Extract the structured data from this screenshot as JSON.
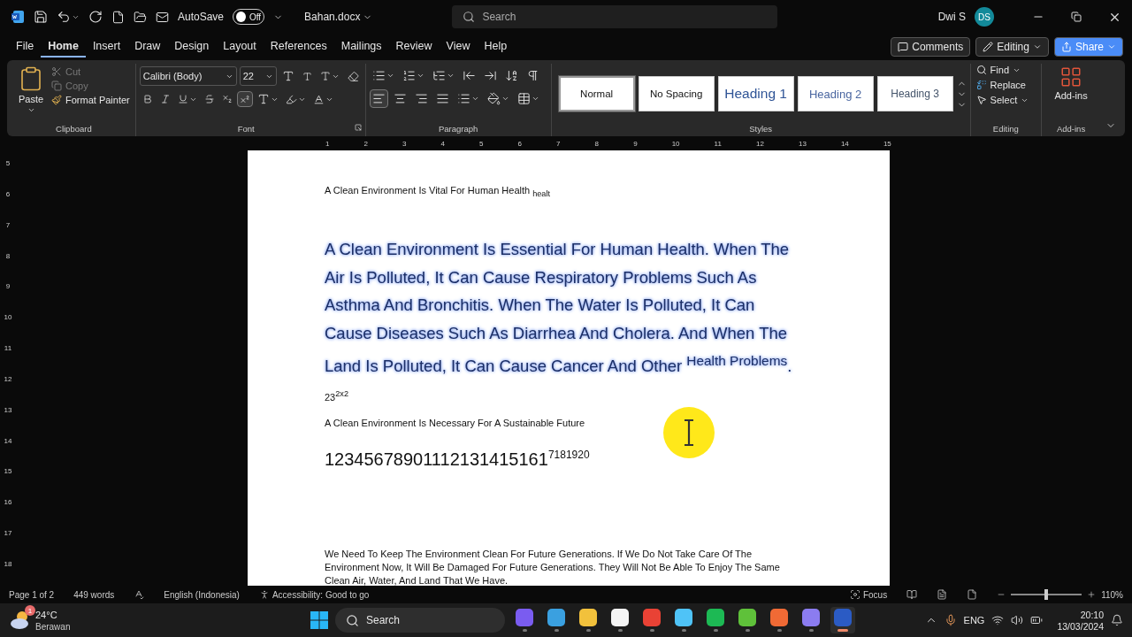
{
  "titlebar": {
    "autosave_label": "AutoSave",
    "autosave_on": false,
    "autosave_state": "Off",
    "filename": "Bahan.docx",
    "search_placeholder": "Search",
    "user_name": "Dwi S",
    "user_initials": "DS"
  },
  "menu_tabs": [
    {
      "label": "File",
      "selected": false
    },
    {
      "label": "Home",
      "selected": true
    },
    {
      "label": "Insert",
      "selected": false
    },
    {
      "label": "Draw",
      "selected": false
    },
    {
      "label": "Design",
      "selected": false
    },
    {
      "label": "Layout",
      "selected": false
    },
    {
      "label": "References",
      "selected": false
    },
    {
      "label": "Mailings",
      "selected": false
    },
    {
      "label": "Review",
      "selected": false
    },
    {
      "label": "View",
      "selected": false
    },
    {
      "label": "Help",
      "selected": false
    }
  ],
  "actions": {
    "comments": "Comments",
    "editing": "Editing",
    "share": "Share"
  },
  "ribbon": {
    "clipboard": {
      "paste": "Paste",
      "cut": "Cut",
      "copy": "Copy",
      "format_painter": "Format Painter",
      "label": "Clipboard"
    },
    "font": {
      "family": "Calibri (Body)",
      "size": "22",
      "label": "Font",
      "superscript_on": true
    },
    "paragraph": {
      "label": "Paragraph",
      "align_left_on": true
    },
    "styles": {
      "label": "Styles",
      "items": [
        {
          "label": "Normal",
          "kind": "normal",
          "selected": true
        },
        {
          "label": "No Spacing",
          "kind": "normal",
          "selected": false
        },
        {
          "label": "Heading 1",
          "kind": "heading1",
          "selected": false
        },
        {
          "label": "Heading 2",
          "kind": "heading2",
          "selected": false
        },
        {
          "label": "Heading 3",
          "kind": "heading3",
          "selected": false
        }
      ]
    },
    "editing": {
      "find": "Find",
      "replace": "Replace",
      "select": "Select",
      "label": "Editing"
    },
    "addins": {
      "button": "Add-ins",
      "label": "Add-ins"
    }
  },
  "ruler": {
    "numbers": [
      "1",
      "2",
      "3",
      "4",
      "5",
      "6",
      "7",
      "8",
      "9",
      "10",
      "11",
      "12",
      "13",
      "14",
      "15"
    ],
    "vertical_numbers": [
      "5",
      "6",
      "7",
      "8",
      "9",
      "10",
      "11",
      "12",
      "13",
      "14",
      "15",
      "16",
      "17",
      "18"
    ]
  },
  "document": [
    {
      "kind": "line",
      "text": "A Clean Environment Is Vital For Human Health $_{healt}$"
    },
    {
      "kind": "glow",
      "text": "A Clean Environment Is Essential For Human Health. When The Air Is Polluted, It Can Cause Respiratory Problems Such As Asthma And Bronchitis. When The Water Is Polluted, It Can Cause Diseases Such As Diarrhea And Cholera. And When The Land Is Polluted, It Can Cause Cancer And Other $^{Health Problems}$."
    },
    {
      "kind": "line",
      "text": "23$^{2x2}$"
    },
    {
      "kind": "line",
      "text": "A Clean Environment Is Necessary For A Sustainable Future"
    },
    {
      "kind": "big",
      "text": "12345678901112131415161$^{7181920}$"
    },
    {
      "kind": "cursor"
    },
    {
      "kind": "line",
      "text": "We Need To Keep The Environment Clean For Future Generations. If We Do Not Take Care Of The Environment Now, It Will Be Damaged For Future Generations. They Will Not Be Able To Enjoy The Same Clean Air, Water, And Land That We Have."
    }
  ],
  "status_bar": {
    "page": "Page 1 of 2",
    "words": "449 words",
    "language": "English (Indonesia)",
    "accessibility": "Accessibility: Good to go",
    "focus": "Focus",
    "zoom": {
      "level": 0.47,
      "reading": "110%"
    }
  },
  "taskbar": {
    "temperature": "24°C",
    "weather": "Berawan",
    "weather_badge": "1",
    "search_placeholder": "Search",
    "apps": [
      {
        "color": "#7a5cf0",
        "running": false
      },
      {
        "color": "#3aa0e0",
        "running": false
      },
      {
        "color": "#f2c13c",
        "running": false
      },
      {
        "color": "#f5f5f5",
        "running": false
      },
      {
        "color": "#e94235",
        "running": false
      },
      {
        "color": "#4fc3f7",
        "running": false
      },
      {
        "color": "#1db954",
        "running": false
      },
      {
        "color": "#5fc13a",
        "running": false
      },
      {
        "color": "#f06a35",
        "running": false
      },
      {
        "color": "#8b7cf0",
        "running": false
      },
      {
        "color": "#2b5bc4",
        "running": true
      }
    ],
    "language": "ENG",
    "time": "20:10",
    "date": "13/03/2024"
  }
}
